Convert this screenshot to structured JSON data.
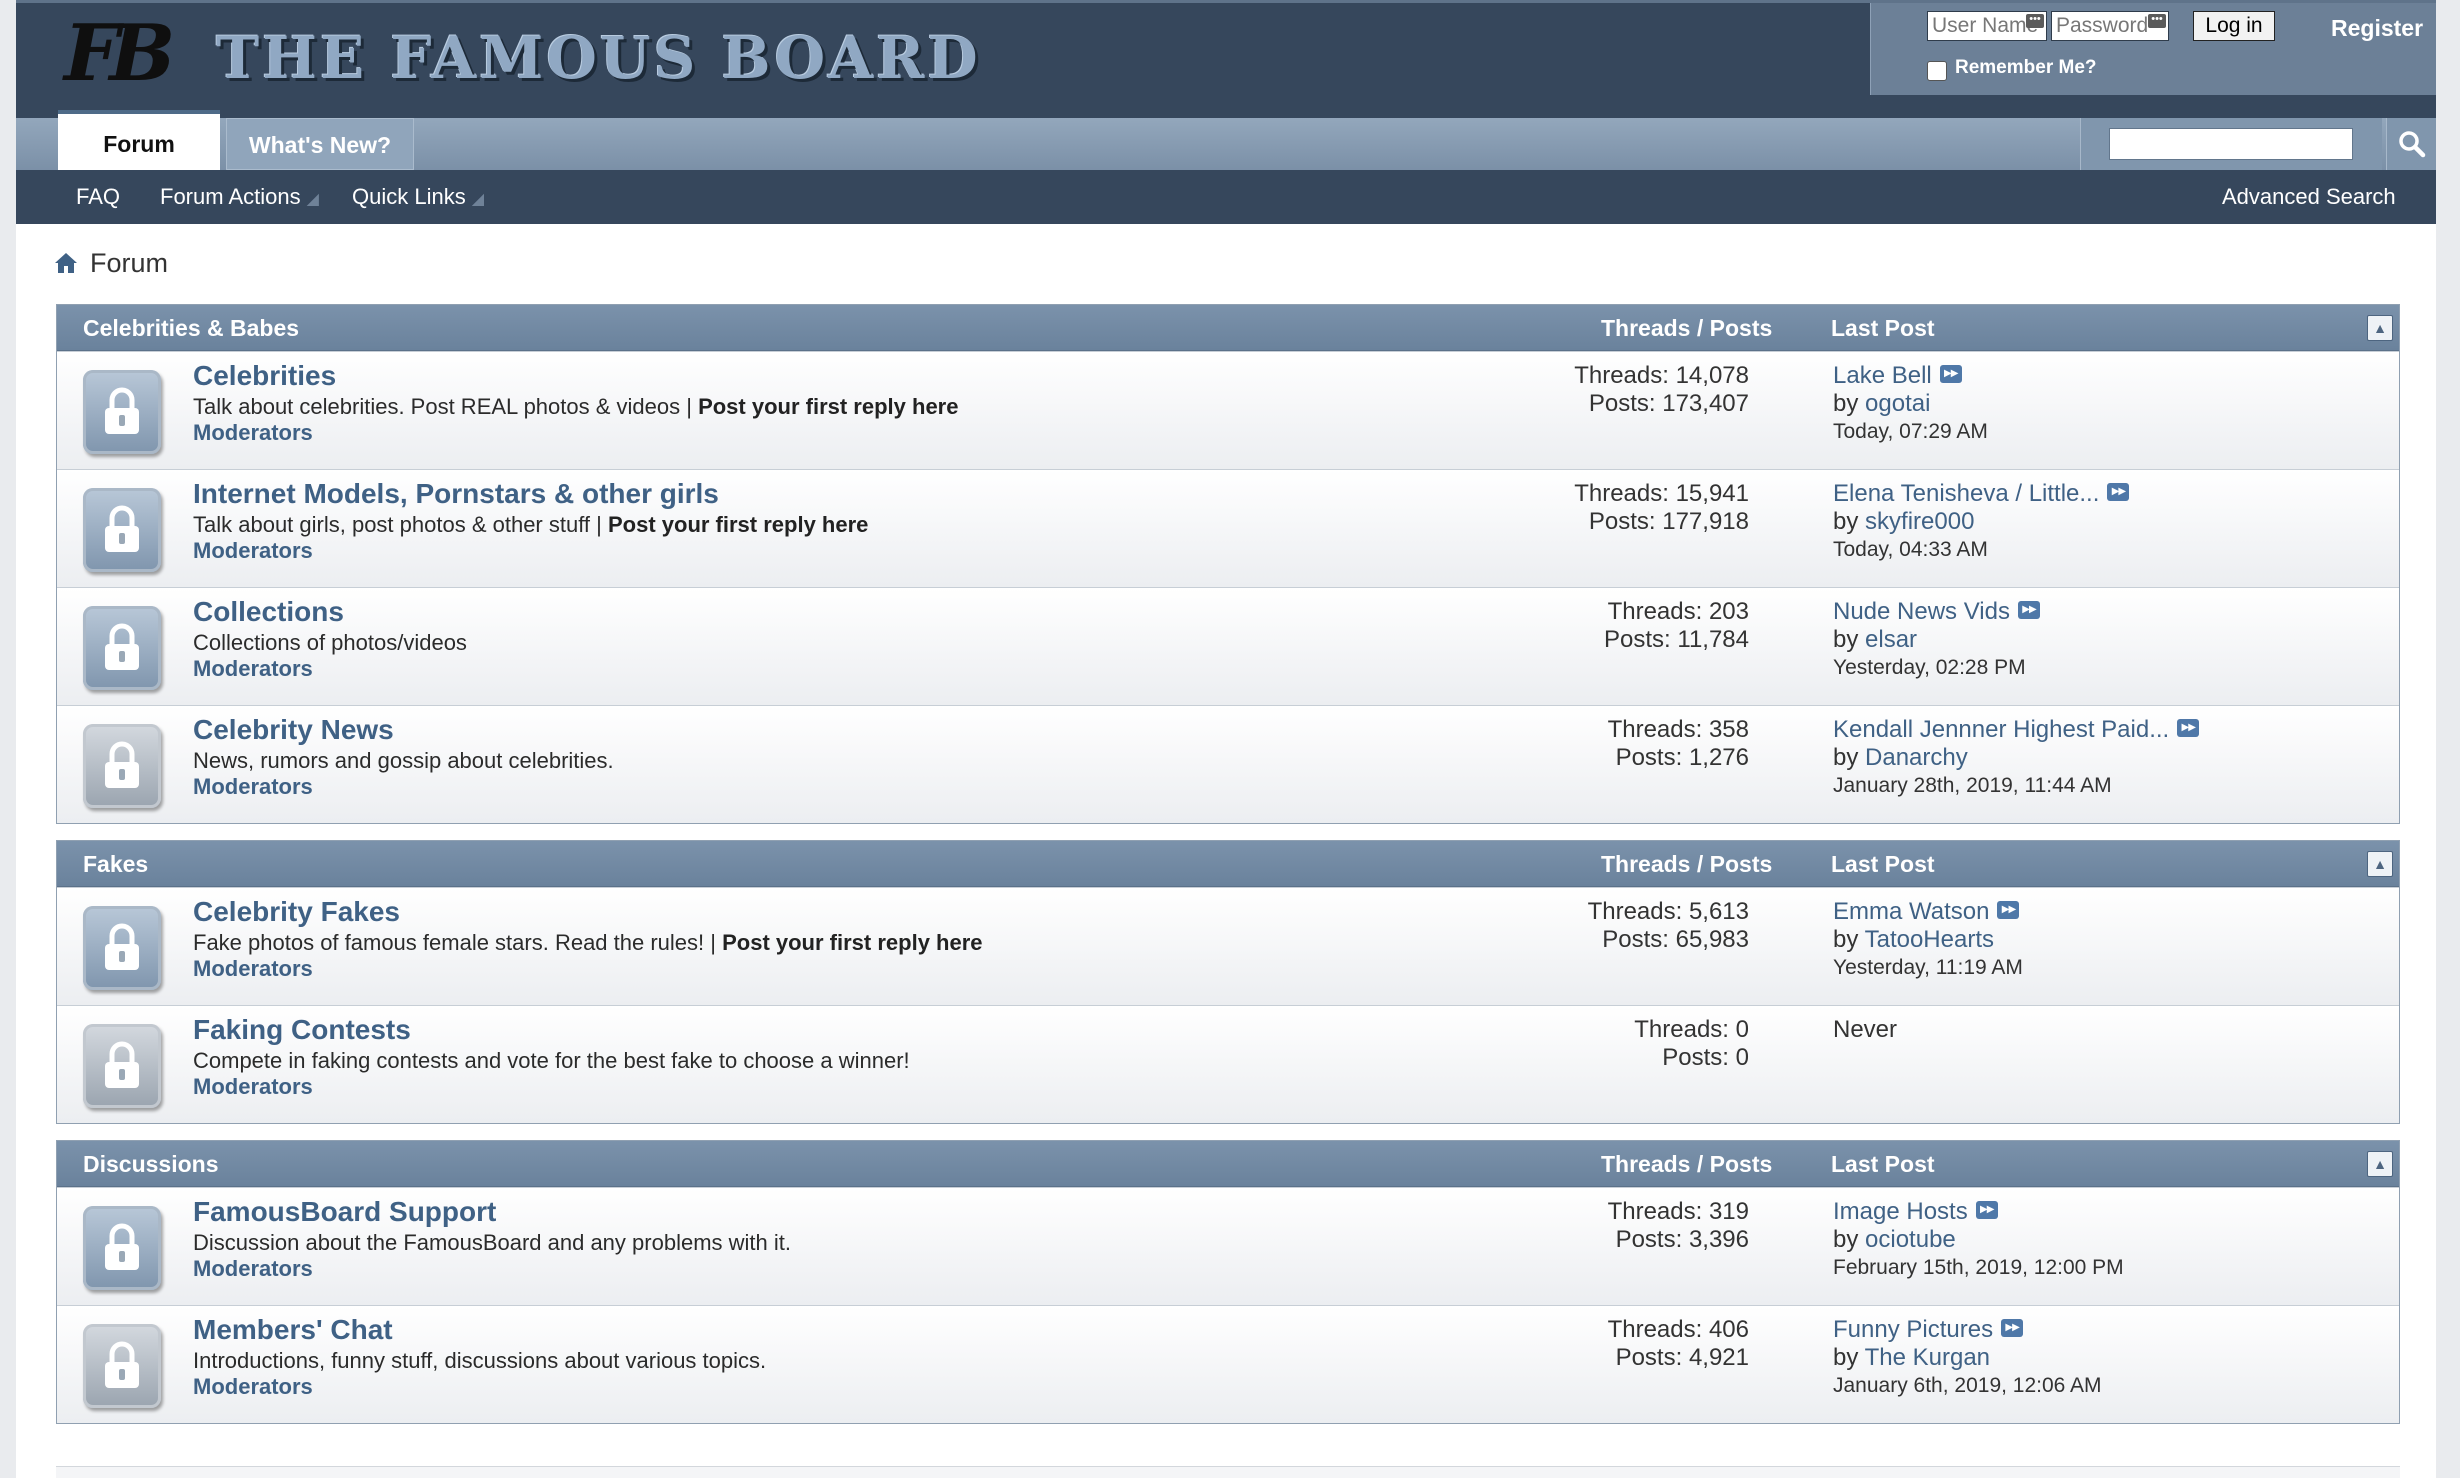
{
  "header": {
    "logo_mark": "FB",
    "logo_text": "THE FAMOUS BOARD",
    "login": {
      "username_placeholder": "User Name",
      "password_placeholder": "Password",
      "login_button": "Log in",
      "register_link": "Register",
      "remember_label": "Remember Me?"
    }
  },
  "tabs": {
    "forum": "Forum",
    "whats_new": "What's New?"
  },
  "subnav": {
    "faq": "FAQ",
    "forum_actions": "Forum Actions",
    "quick_links": "Quick Links",
    "advanced_search": "Advanced Search"
  },
  "breadcrumb": {
    "label": "Forum"
  },
  "column_labels": {
    "threads_posts": "Threads / Posts",
    "last_post": "Last Post"
  },
  "sections": [
    {
      "title": "Celebrities & Babes",
      "forums": [
        {
          "title": "Celebrities",
          "desc": "Talk about celebrities. Post REAL photos & videos | ",
          "desc_bold": "Post your first reply here",
          "mods": "Moderators",
          "threads": "Threads: 14,078",
          "posts": "Posts: 173,407",
          "last_title": "Lake Bell",
          "by": "by",
          "last_user": "ogotai",
          "last_date": "Today, 07:29 AM"
        },
        {
          "title": "Internet Models, Pornstars & other girls",
          "desc": "Talk about girls, post photos & other stuff | ",
          "desc_bold": "Post your first reply here",
          "mods": "Moderators",
          "threads": "Threads: 15,941",
          "posts": "Posts: 177,918",
          "last_title": "Elena Tenisheva / Little...",
          "by": "by",
          "last_user": "skyfire000",
          "last_date": "Today, 04:33 AM"
        },
        {
          "title": "Collections",
          "desc": "Collections of photos/videos",
          "desc_bold": "",
          "mods": "Moderators",
          "threads": "Threads: 203",
          "posts": "Posts: 11,784",
          "last_title": "Nude News Vids",
          "by": "by",
          "last_user": "elsar",
          "last_date": "Yesterday, 02:28 PM"
        },
        {
          "title": "Celebrity News",
          "desc": "News, rumors and gossip about celebrities.",
          "desc_bold": "",
          "mods": "Moderators",
          "threads": "Threads: 358",
          "posts": "Posts: 1,276",
          "last_title": "Kendall Jennner Highest Paid...",
          "by": "by",
          "last_user": "Danarchy",
          "last_date": "January 28th, 2019, 11:44 AM"
        }
      ]
    },
    {
      "title": "Fakes",
      "forums": [
        {
          "title": "Celebrity Fakes",
          "desc": "Fake photos of famous female stars. Read the rules! | ",
          "desc_bold": "Post your first reply here",
          "mods": "Moderators",
          "threads": "Threads: 5,613",
          "posts": "Posts: 65,983",
          "last_title": "Emma Watson",
          "by": "by",
          "last_user": "TatooHearts",
          "last_date": "Yesterday, 11:19 AM"
        },
        {
          "title": "Faking Contests",
          "desc": "Compete in faking contests and vote for the best fake to choose a winner!",
          "desc_bold": "",
          "mods": "Moderators",
          "threads": "Threads: 0",
          "posts": "Posts: 0",
          "never": "Never"
        }
      ]
    },
    {
      "title": "Discussions",
      "forums": [
        {
          "title": "FamousBoard Support",
          "desc": "Discussion about the FamousBoard and any problems with it.",
          "desc_bold": "",
          "mods": "Moderators",
          "threads": "Threads: 319",
          "posts": "Posts: 3,396",
          "last_title": "Image Hosts",
          "by": "by",
          "last_user": "ociotube",
          "last_date": "February 15th, 2019, 12:00 PM"
        },
        {
          "title": "Members' Chat",
          "desc": "Introductions, funny stuff, discussions about various topics.",
          "desc_bold": "",
          "mods": "Moderators",
          "threads": "Threads: 406",
          "posts": "Posts: 4,921",
          "last_title": "Funny Pictures",
          "by": "by",
          "last_user": "The Kurgan",
          "last_date": "January 6th, 2019, 12:06 AM"
        }
      ]
    }
  ],
  "colors": {
    "header_bg": "#36475c",
    "link": "#3f6185",
    "section_head": "#7b92ab"
  },
  "icons": {
    "home": "home-icon",
    "search": "search-icon",
    "lock": "lock-icon",
    "goto": "go-to-post-icon",
    "collapse": "collapse-icon"
  }
}
